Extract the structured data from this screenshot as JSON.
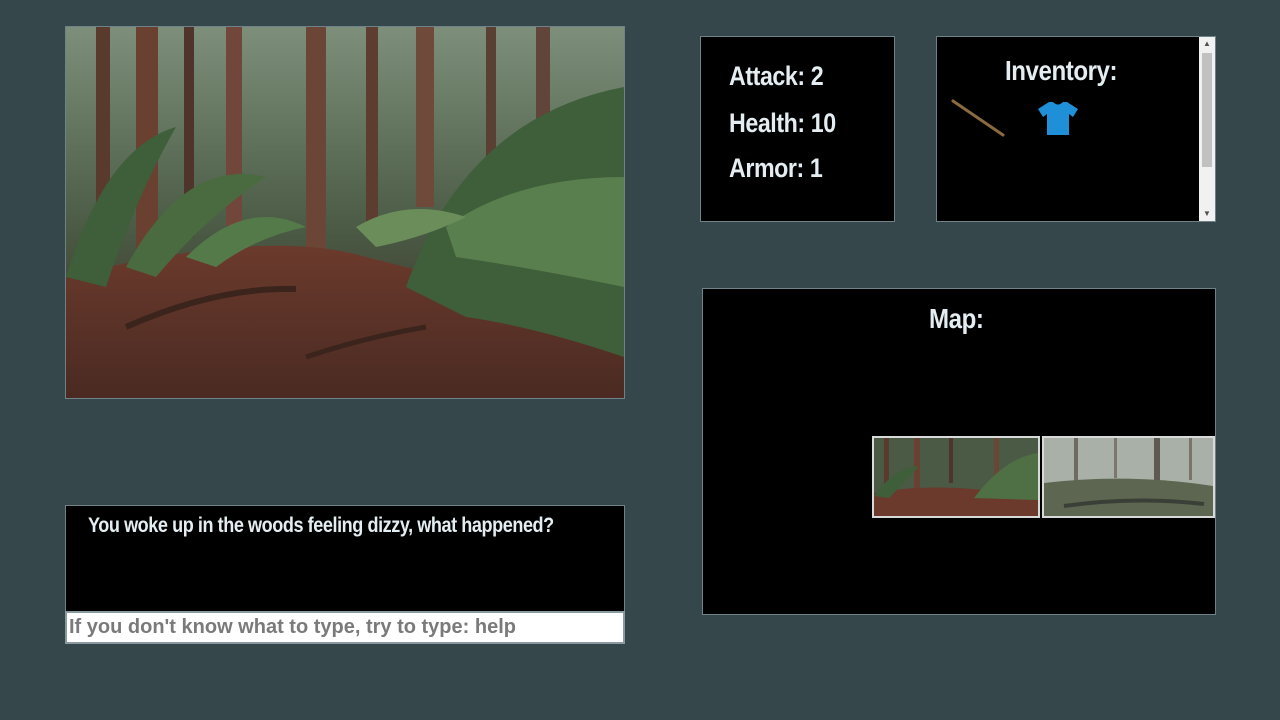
{
  "stats": {
    "attack": "Attack: 2",
    "health": "Health: 10",
    "armor": "Armor: 1"
  },
  "inventory": {
    "title": "Inventory:",
    "items": [
      "stick-icon",
      "shirt-icon"
    ]
  },
  "map": {
    "title": "Map:",
    "tiles": [
      "forest-trail",
      "misty-clearing"
    ]
  },
  "log": {
    "message": "You woke up in the woods feeling dizzy, what happened?"
  },
  "command": {
    "placeholder": "If you don't know what to type, try to type: help",
    "value": ""
  },
  "colors": {
    "background": "#36474c",
    "panel": "#000000",
    "text": "#e4eef2",
    "shirt": "#1f8fd8"
  }
}
